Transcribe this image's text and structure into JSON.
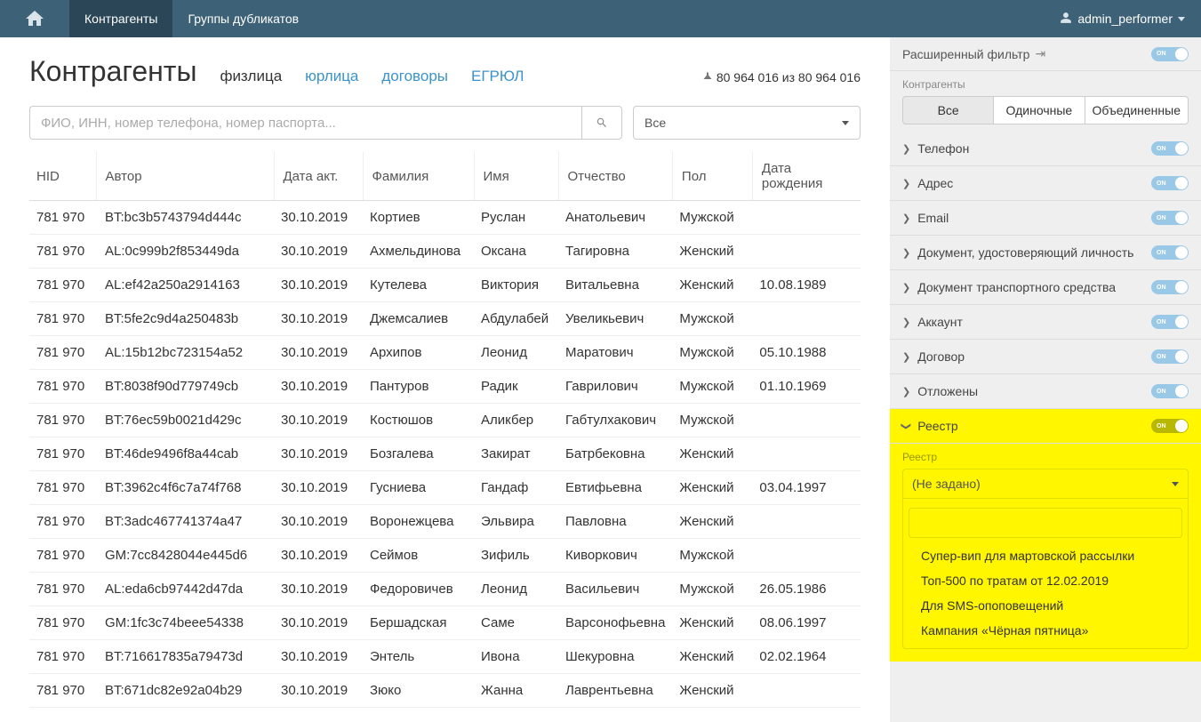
{
  "nav": {
    "item1": "Контрагенты",
    "item2": "Группы дубликатов",
    "user": "admin_performer"
  },
  "page": {
    "title": "Контрагенты",
    "filter_fiz": "физлица",
    "filter_yur": "юрлица",
    "filter_dog": "договоры",
    "filter_egrul": "ЕГРЮЛ",
    "count": "80 964 016 из 80 964 016"
  },
  "search": {
    "placeholder": "ФИО, ИНН, номер телефона, номер паспорта...",
    "dropdown": "Все"
  },
  "cols": {
    "hid": "HID",
    "author": "Автор",
    "date_act": "Дата акт.",
    "surname": "Фамилия",
    "name": "Имя",
    "patronymic": "Отчество",
    "sex": "Пол",
    "dob": "Дата рождения"
  },
  "rows": [
    {
      "hid": "781 970",
      "author": "BT:bc3b5743794d444c",
      "date": "30.10.2019",
      "sn": "Кортиев",
      "n": "Руслан",
      "pt": "Анатольевич",
      "sex": "Мужской",
      "dob": ""
    },
    {
      "hid": "781 970",
      "author": "AL:0c999b2f853449da",
      "date": "30.10.2019",
      "sn": "Ахмельдинова",
      "n": "Оксана",
      "pt": "Тагировна",
      "sex": "Женский",
      "dob": ""
    },
    {
      "hid": "781 970",
      "author": "AL:ef42a250a2914163",
      "date": "30.10.2019",
      "sn": "Кутелева",
      "n": "Виктория",
      "pt": "Витальевна",
      "sex": "Женский",
      "dob": "10.08.1989"
    },
    {
      "hid": "781 970",
      "author": "BT:5fe2c9d4a250483b",
      "date": "30.10.2019",
      "sn": "Джемсалиев",
      "n": "Абдулабей",
      "pt": "Увеликьевич",
      "sex": "Мужской",
      "dob": ""
    },
    {
      "hid": "781 970",
      "author": "AL:15b12bc723154a52",
      "date": "30.10.2019",
      "sn": "Архипов",
      "n": "Леонид",
      "pt": "Маратович",
      "sex": "Мужской",
      "dob": "05.10.1988"
    },
    {
      "hid": "781 970",
      "author": "BT:8038f90d779749cb",
      "date": "30.10.2019",
      "sn": "Пантуров",
      "n": "Радик",
      "pt": "Гаврилович",
      "sex": "Мужской",
      "dob": "01.10.1969"
    },
    {
      "hid": "781 970",
      "author": "BT:76ec59b0021d429c",
      "date": "30.10.2019",
      "sn": "Костюшов",
      "n": "Аликбер",
      "pt": "Габтулхакович",
      "sex": "Мужской",
      "dob": ""
    },
    {
      "hid": "781 970",
      "author": "BT:46de9496f8a44cab",
      "date": "30.10.2019",
      "sn": "Бозгалева",
      "n": "Закират",
      "pt": "Батрбековна",
      "sex": "Женский",
      "dob": ""
    },
    {
      "hid": "781 970",
      "author": "BT:3962c4f6c7a74f768",
      "date": "30.10.2019",
      "sn": "Гусниева",
      "n": "Гандаф",
      "pt": "Евтифьевна",
      "sex": "Женский",
      "dob": "03.04.1997"
    },
    {
      "hid": "781 970",
      "author": "BT:3adc467741374a47",
      "date": "30.10.2019",
      "sn": "Воронежцева",
      "n": "Эльвира",
      "pt": "Павловна",
      "sex": "Женский",
      "dob": ""
    },
    {
      "hid": "781 970",
      "author": "GM:7cc8428044e445d6",
      "date": "30.10.2019",
      "sn": "Сеймов",
      "n": "Зифиль",
      "pt": "Киворкович",
      "sex": "Мужской",
      "dob": ""
    },
    {
      "hid": "781 970",
      "author": "AL:eda6cb97442d47da",
      "date": "30.10.2019",
      "sn": "Федоровичев",
      "n": "Леонид",
      "pt": "Васильевич",
      "sex": "Мужской",
      "dob": "26.05.1986"
    },
    {
      "hid": "781 970",
      "author": "GM:1fc3c74beee54338",
      "date": "30.10.2019",
      "sn": "Бершадская",
      "n": "Саме",
      "pt": "Варсонофьевна",
      "sex": "Женский",
      "dob": "08.06.1997"
    },
    {
      "hid": "781 970",
      "author": "BT:716617835a79473d",
      "date": "30.10.2019",
      "sn": "Энтель",
      "n": "Ивона",
      "pt": "Шекуровна",
      "sex": "Женский",
      "dob": "02.02.1964"
    },
    {
      "hid": "781 970",
      "author": "BT:671dc82e92a04b29",
      "date": "30.10.2019",
      "sn": "Зюко",
      "n": "Жанна",
      "pt": "Лаврентьевна",
      "sex": "Женский",
      "dob": ""
    }
  ],
  "panel": {
    "header": "Расширенный фильтр",
    "kontr_label": "Контрагенты",
    "btn_all": "Все",
    "btn_single": "Одиночные",
    "btn_merged": "Объединенные",
    "filters": {
      "tel": "Телефон",
      "addr": "Адрес",
      "email": "Email",
      "doc_id": "Документ, удостоверяющий личность",
      "doc_ts": "Документ транспортного средства",
      "acc": "Аккаунт",
      "dog": "Договор",
      "postponed": "Отложены",
      "reg": "Реестр"
    },
    "reg_label": "Реестр",
    "reg_placeholder": "(Не задано)",
    "reg_options": [
      "Супер-вип для мартовской рассылки",
      "Топ-500 по тратам от 12.02.2019",
      "Для SMS-опоповещений",
      "Кампания «Чёрная пятница»"
    ]
  }
}
